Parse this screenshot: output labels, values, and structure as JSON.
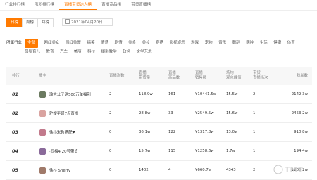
{
  "tabs": [
    "行业排行榜",
    "涨粉排行榜",
    "直播带货达人榜",
    "直播商品榜",
    "带货直播榜"
  ],
  "active_tab_index": 2,
  "period": {
    "options": [
      "日榜",
      "周榜",
      "月榜"
    ],
    "selected": "日榜"
  },
  "date": "2021年04月20日",
  "category": {
    "label": "所属行业",
    "items": [
      "全部",
      "网红美女",
      "网红帅哥",
      "搞笑",
      "情感",
      "剧情",
      "美食",
      "美妆",
      "穿搭",
      "影视娱乐",
      "游戏",
      "宠物",
      "音乐",
      "舞蹈",
      "萌娃",
      "生活",
      "健康",
      "体育",
      "母婴育儿",
      "教育",
      "汽车",
      "美丽",
      "科技",
      "摄影教学",
      "政务",
      "文学艺术"
    ],
    "selected": "全部"
  },
  "table": {
    "headers": [
      "排行",
      "播主",
      "直播次数",
      "直播\n带货量",
      "直播\n商品数",
      "直播\n销售额",
      "场均\n观众峰值",
      "带货\n直播场次",
      "粉丝数"
    ],
    "rows": [
      {
        "rank": "01",
        "name": "瑜大公子送500万单福利",
        "times": "2",
        "goods_sales": "118.9w",
        "products": "161",
        "gmv": "¥10441.5w",
        "peak": "15.5w",
        "sessions": "2",
        "fans": "2142.3w",
        "avatar_color": "#6b7a60"
      },
      {
        "rank": "02",
        "name": "驴嫂平哥7点直播",
        "times": "2",
        "goods_sales": "28.8w",
        "products": "33",
        "gmv": "¥2549.5w",
        "peak": "15.6w",
        "sessions": "1",
        "fans": "2453.2w",
        "avatar_color": "#d9a3a0"
      },
      {
        "rank": "03",
        "name": "徐小米教搭配❤",
        "times": "0",
        "goods_sales": "36.1w",
        "products": "122",
        "gmv": "¥1317.8w",
        "peak": "13.0w",
        "sessions": "1",
        "fans": "910.8w",
        "avatar_color": "#c27a8c"
      },
      {
        "rank": "04",
        "name": "·西梅4.20号带货",
        "times": "0",
        "goods_sales": "15.7w",
        "products": "115",
        "gmv": "¥1258.6w",
        "peak": "1.7w",
        "sessions": "1",
        "fans": "194.4w",
        "avatar_color": "#8a6a9a"
      },
      {
        "rank": "05",
        "name": "徐杉 Sherry",
        "times": "0",
        "goods_sales": "1402",
        "products": "4",
        "gmv": "¥660.7w",
        "peak": "4343",
        "sessions": "2",
        "fans": "1200.2w",
        "avatar_color": "#a07a6a"
      }
    ]
  },
  "watermark": "TMT"
}
